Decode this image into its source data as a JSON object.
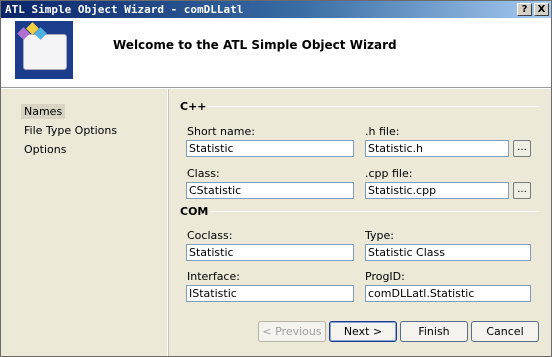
{
  "window": {
    "title": "ATL Simple Object Wizard - comDLLatl",
    "help_button": "?",
    "close_button": "X"
  },
  "header": {
    "title": "Welcome to the ATL Simple Object Wizard"
  },
  "sidebar": {
    "items": [
      {
        "label": "Names",
        "selected": true
      },
      {
        "label": "File Type Options",
        "selected": false
      },
      {
        "label": "Options",
        "selected": false
      }
    ]
  },
  "cpp_group": {
    "label": "C++",
    "short_name": {
      "label": "Short name:",
      "value": "Statistic"
    },
    "h_file": {
      "label": ".h file:",
      "value": "Statistic.h"
    },
    "class": {
      "label": "Class:",
      "value": "CStatistic"
    },
    "cpp_file": {
      "label": ".cpp file:",
      "value": "Statistic.cpp"
    },
    "browse_label": "..."
  },
  "com_group": {
    "label": "COM",
    "coclass": {
      "label": "Coclass:",
      "value": "Statistic"
    },
    "type": {
      "label": "Type:",
      "value": "Statistic Class"
    },
    "interface": {
      "label": "Interface:",
      "value": "IStatistic"
    },
    "progid": {
      "label": "ProgID:",
      "value": "comDLLatl.Statistic"
    }
  },
  "buttons": {
    "previous": "< Previous",
    "next": "Next >",
    "finish": "Finish",
    "cancel": "Cancel"
  },
  "colors": {
    "titlebar_start": "#0a246a",
    "titlebar_end": "#a6caf0",
    "panel_bg": "#ece9d8",
    "logo_bg": "#1c3c8c"
  }
}
